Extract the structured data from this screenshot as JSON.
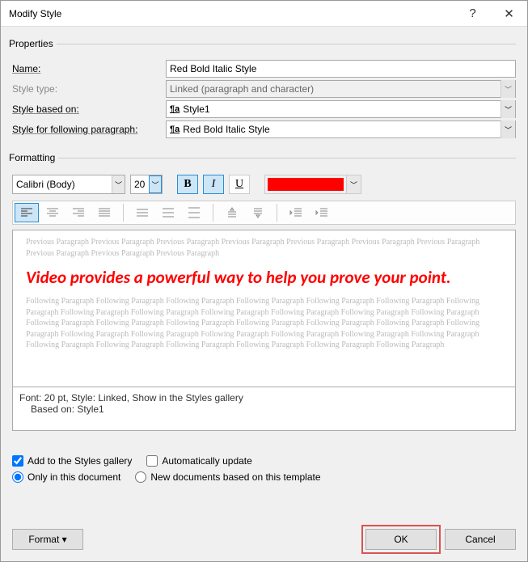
{
  "title": "Modify Style",
  "properties": {
    "legend": "Properties",
    "name_label": "Name:",
    "name_value": "Red Bold Italic Style",
    "type_label": "Style type:",
    "type_value": "Linked (paragraph and character)",
    "based_label": "Style based on:",
    "based_value": "Style1",
    "following_label": "Style for following paragraph:",
    "following_value": "Red Bold Italic Style"
  },
  "formatting": {
    "legend": "Formatting",
    "font": "Calibri (Body)",
    "size": "20",
    "bold_glyph": "B",
    "italic_glyph": "I",
    "underline_glyph": "U",
    "color": "#ff0000"
  },
  "preview": {
    "prev_para": "Previous Paragraph Previous Paragraph Previous Paragraph Previous Paragraph Previous Paragraph Previous Paragraph Previous Paragraph Previous Paragraph Previous Paragraph Previous Paragraph",
    "sample": "Video provides a powerful way to help you prove your point.",
    "next_para": "Following Paragraph Following Paragraph Following Paragraph Following Paragraph Following Paragraph Following Paragraph Following Paragraph Following Paragraph Following Paragraph Following Paragraph Following Paragraph Following Paragraph Following Paragraph Following Paragraph Following Paragraph Following Paragraph Following Paragraph Following Paragraph Following Paragraph Following Paragraph Following Paragraph Following Paragraph Following Paragraph Following Paragraph Following Paragraph Following Paragraph Following Paragraph Following Paragraph Following Paragraph Following Paragraph Following Paragraph Following Paragraph"
  },
  "description": {
    "line1": "Font: 20 pt, Style: Linked, Show in the Styles gallery",
    "line2": "Based on: Style1"
  },
  "options": {
    "add_gallery": "Add to the Styles gallery",
    "auto_update": "Automatically update",
    "only_doc": "Only in this document",
    "new_docs": "New documents based on this template"
  },
  "buttons": {
    "format": "Format ▾",
    "ok": "OK",
    "cancel": "Cancel"
  }
}
